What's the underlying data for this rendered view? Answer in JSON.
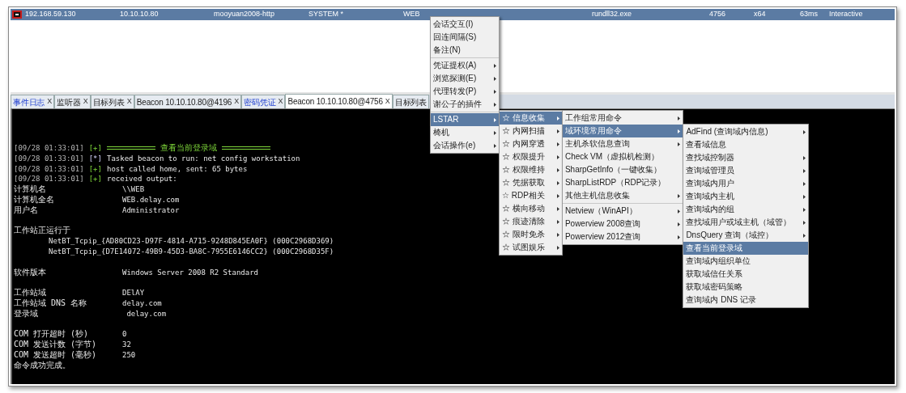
{
  "session_row": {
    "selected": true,
    "cells": [
      "192.168.59.130",
      "10.10.10.80",
      "mooyuan2008-http",
      "SYSTEM *",
      "WEB",
      "rundll32.exe",
      "4756",
      "x64",
      "63ms",
      "Interactive"
    ]
  },
  "tabs": [
    {
      "label": "事件日志",
      "close": "X",
      "highlighted": true,
      "selected": false
    },
    {
      "label": "监听器",
      "close": "X",
      "highlighted": false,
      "selected": false
    },
    {
      "label": "目标列表",
      "close": "X",
      "highlighted": false,
      "selected": false
    },
    {
      "label": "Beacon 10.10.10.80@4196",
      "close": "X",
      "highlighted": false,
      "selected": false
    },
    {
      "label": "密码凭证",
      "close": "X",
      "highlighted": true,
      "selected": false
    },
    {
      "label": "Beacon 10.10.10.80@4756",
      "close": "X",
      "highlighted": false,
      "selected": true
    },
    {
      "label": "目标列表",
      "highlighted": false,
      "selected": false
    }
  ],
  "console": [
    {
      "kind": "banner",
      "time": "[09/28 01:33:01]",
      "marker": "[+]",
      "text": "查看当前登录域"
    },
    {
      "kind": "info",
      "time": "[09/28 01:33:01]",
      "marker": "[*]",
      "text": "Tasked beacon to run: net config workstation"
    },
    {
      "kind": "success",
      "time": "[09/28 01:33:01]",
      "marker": "[+]",
      "text": "host called home, sent: 65 bytes"
    },
    {
      "kind": "success",
      "time": "[09/28 01:33:01]",
      "marker": "[+]",
      "text": "received output:"
    },
    {
      "kind": "field",
      "label": "计算机名",
      "value": "\\\\WEB"
    },
    {
      "kind": "field",
      "label": "计算机全名",
      "value": "WEB.delay.com"
    },
    {
      "kind": "field",
      "label": "用户名",
      "value": "Administrator"
    },
    {
      "kind": "blank"
    },
    {
      "kind": "plain",
      "text": "工作站正运行于"
    },
    {
      "kind": "indent",
      "text": "NetBT_Tcpip_{AD80CD23-D97F-4814-A715-9248D845EA0F} (000C2968D369)"
    },
    {
      "kind": "indent",
      "text": "NetBT_Tcpip_{D7E14072-49B9-45D3-BA8C-7955E6146CC2} (000C2968D35F)"
    },
    {
      "kind": "blank"
    },
    {
      "kind": "field",
      "label": "软件版本",
      "value": "Windows Server 2008 R2 Standard"
    },
    {
      "kind": "blank"
    },
    {
      "kind": "field",
      "label": "工作站域",
      "value": "DElAY"
    },
    {
      "kind": "field",
      "label": "工作站域 DNS 名称",
      "value": "delay.com"
    },
    {
      "kind": "field",
      "label": "登录域",
      "value": " delay.com"
    },
    {
      "kind": "blank"
    },
    {
      "kind": "field",
      "label": "COM 打开超时 (秒)",
      "value": "0"
    },
    {
      "kind": "field",
      "label": "COM 发送计数 (字节)",
      "value": "32"
    },
    {
      "kind": "field",
      "label": "COM 发送超时 (毫秒)",
      "value": "250"
    },
    {
      "kind": "plain",
      "text": "命令成功完成。"
    }
  ],
  "menus": [
    {
      "items": [
        {
          "kind": "item",
          "label": "会话交互(I)",
          "submenu": false,
          "selected": false
        },
        {
          "kind": "item",
          "label": "回连间隔(S)",
          "submenu": false,
          "selected": false
        },
        {
          "kind": "item",
          "label": "备注(N)",
          "submenu": false,
          "selected": false
        },
        {
          "kind": "separator"
        },
        {
          "kind": "item",
          "label": "凭证提权(A)",
          "submenu": true,
          "selected": false
        },
        {
          "kind": "item",
          "label": "浏览探测(E)",
          "submenu": true,
          "selected": false
        },
        {
          "kind": "item",
          "label": "代理转发(P)",
          "submenu": true,
          "selected": false
        },
        {
          "kind": "item",
          "label": "谢公子的插件",
          "submenu": true,
          "selected": false
        },
        {
          "kind": "separator"
        },
        {
          "kind": "item",
          "label": "LSTAR",
          "submenu": true,
          "selected": true
        },
        {
          "kind": "item",
          "label": "椅机",
          "submenu": true,
          "selected": false
        },
        {
          "kind": "item",
          "label": "会话操作(e)",
          "submenu": true,
          "selected": false
        }
      ]
    },
    {
      "items": [
        {
          "kind": "item",
          "label": "☆ 信息收集",
          "submenu": true,
          "selected": true
        },
        {
          "kind": "item",
          "label": "☆ 内网扫描",
          "submenu": true,
          "selected": false
        },
        {
          "kind": "item",
          "label": "☆ 内网穿透",
          "submenu": true,
          "selected": false
        },
        {
          "kind": "item",
          "label": "☆ 权限提升",
          "submenu": true,
          "selected": false
        },
        {
          "kind": "item",
          "label": "☆ 权限维持",
          "submenu": true,
          "selected": false
        },
        {
          "kind": "item",
          "label": "☆ 凭据获取",
          "submenu": true,
          "selected": false
        },
        {
          "kind": "item",
          "label": "☆ RDP相关",
          "submenu": true,
          "selected": false
        },
        {
          "kind": "item",
          "label": "☆ 横向移动",
          "submenu": true,
          "selected": false
        },
        {
          "kind": "item",
          "label": "☆ 痕迹清除",
          "submenu": true,
          "selected": false
        },
        {
          "kind": "item",
          "label": "☆ 限时免杀",
          "submenu": true,
          "selected": false
        },
        {
          "kind": "item",
          "label": "☆ 试图娱乐",
          "submenu": true,
          "selected": false
        }
      ]
    },
    {
      "items": [
        {
          "kind": "item",
          "label": "工作组常用命令",
          "submenu": true,
          "selected": false
        },
        {
          "kind": "item",
          "label": "域环境常用命令",
          "submenu": true,
          "selected": true
        },
        {
          "kind": "item",
          "label": "主机杀软信息查询",
          "submenu": true,
          "selected": false
        },
        {
          "kind": "item",
          "label": "Check VM（虚拟机检测）",
          "submenu": false,
          "selected": false
        },
        {
          "kind": "item",
          "label": "SharpGetInfo（一键收集）",
          "submenu": false,
          "selected": false
        },
        {
          "kind": "item",
          "label": "SharpListRDP（RDP记录）",
          "submenu": false,
          "selected": false
        },
        {
          "kind": "item",
          "label": "其他主机信息收集",
          "submenu": true,
          "selected": false
        },
        {
          "kind": "separator"
        },
        {
          "kind": "item",
          "label": "Netview（WinAPI）",
          "submenu": true,
          "selected": false
        },
        {
          "kind": "item",
          "label": "Powerview 2008查询",
          "submenu": true,
          "selected": false
        },
        {
          "kind": "item",
          "label": "Powerview 2012查询",
          "submenu": true,
          "selected": false
        }
      ]
    },
    {
      "items": [
        {
          "kind": "item",
          "label": "AdFind (查询域内信息)",
          "submenu": true,
          "selected": false
        },
        {
          "kind": "item",
          "label": "查看域信息",
          "submenu": false,
          "selected": false
        },
        {
          "kind": "item",
          "label": "查找域控制器",
          "submenu": true,
          "selected": false
        },
        {
          "kind": "item",
          "label": "查询域管理员",
          "submenu": true,
          "selected": false
        },
        {
          "kind": "item",
          "label": "查询域内用户",
          "submenu": true,
          "selected": false
        },
        {
          "kind": "item",
          "label": "查询域内主机",
          "submenu": true,
          "selected": false
        },
        {
          "kind": "item",
          "label": "查询域内的组",
          "submenu": true,
          "selected": false
        },
        {
          "kind": "item",
          "label": "查找域用户或域主机（域管）",
          "submenu": true,
          "selected": false
        },
        {
          "kind": "item",
          "label": "DnsQuery 查询（域控）",
          "submenu": true,
          "selected": false
        },
        {
          "kind": "item",
          "label": "查看当前登录域",
          "submenu": false,
          "selected": true
        },
        {
          "kind": "item",
          "label": "查询域内组织单位",
          "submenu": false,
          "selected": false
        },
        {
          "kind": "item",
          "label": "获取域信任关系",
          "submenu": false,
          "selected": false
        },
        {
          "kind": "item",
          "label": "获取域密码策略",
          "submenu": false,
          "selected": false
        },
        {
          "kind": "item",
          "label": "查询域内 DNS 记录",
          "submenu": false,
          "selected": false
        }
      ]
    }
  ]
}
